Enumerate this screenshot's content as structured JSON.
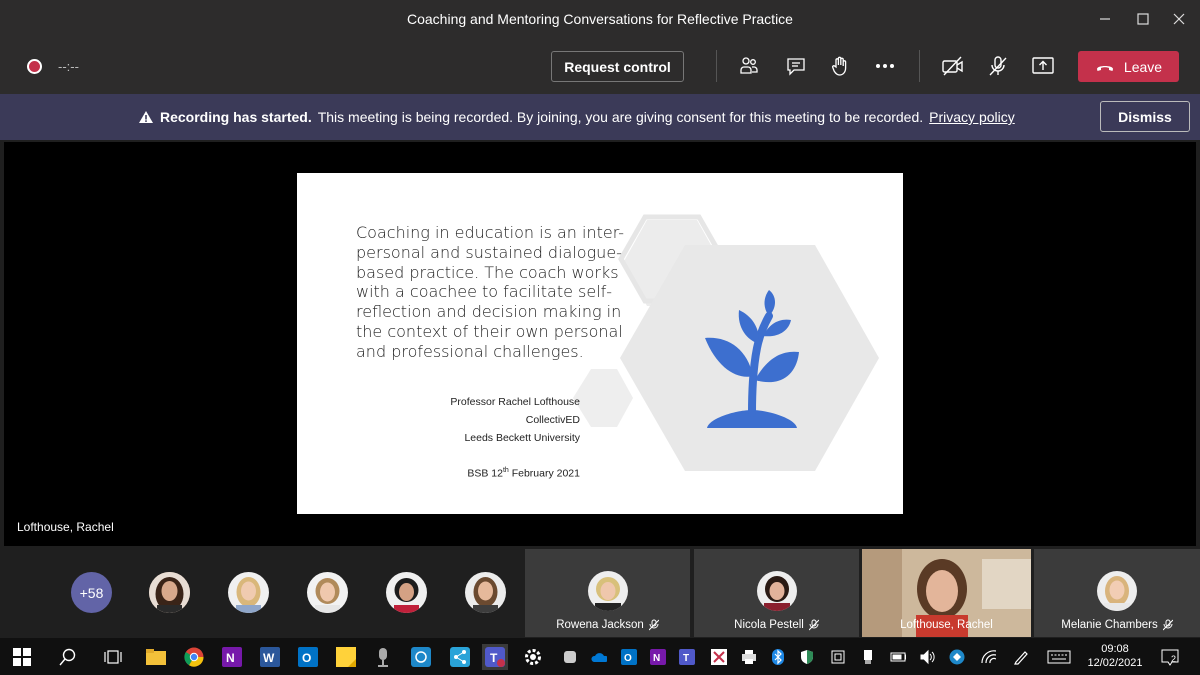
{
  "window": {
    "title": "Coaching and Mentoring Conversations for Reflective Practice"
  },
  "controls": {
    "timer": "--:--",
    "request_control": "Request control",
    "leave": "Leave"
  },
  "banner": {
    "bold": "Recording has started.",
    "text": "This meeting is being recorded. By joining, you are giving consent for this meeting to be recorded.",
    "link": "Privacy policy",
    "dismiss": "Dismiss"
  },
  "slide": {
    "lines": [
      "Coaching in education is an inter-",
      "personal and sustained dialogue-",
      "based practice. The coach works",
      "with a coachee to facilitate self-",
      "reflection and decision making in",
      "the context of their own personal",
      "and professional challenges."
    ],
    "author": "Professor Rachel Lofthouse",
    "org": "CollectivED",
    "university": "Leeds Beckett University",
    "date_prefix": "BSB 12",
    "date_sup": "th",
    "date_suffix": " February 2021"
  },
  "presenter": "Lofthouse, Rachel",
  "gallery": {
    "more_count": "+58",
    "tiles": [
      {
        "name": "Rowena Jackson"
      },
      {
        "name": "Nicola Pestell"
      },
      {
        "name": "Lofthouse, Rachel"
      },
      {
        "name": "Melanie Chambers"
      }
    ]
  },
  "taskbar": {
    "time": "09:08",
    "date": "12/02/2021",
    "notifications": "2"
  },
  "colors": {
    "leave": "#c4314b",
    "banner": "#3b3a58",
    "badge": "#6264a7",
    "plant": "#3d6fcf"
  }
}
